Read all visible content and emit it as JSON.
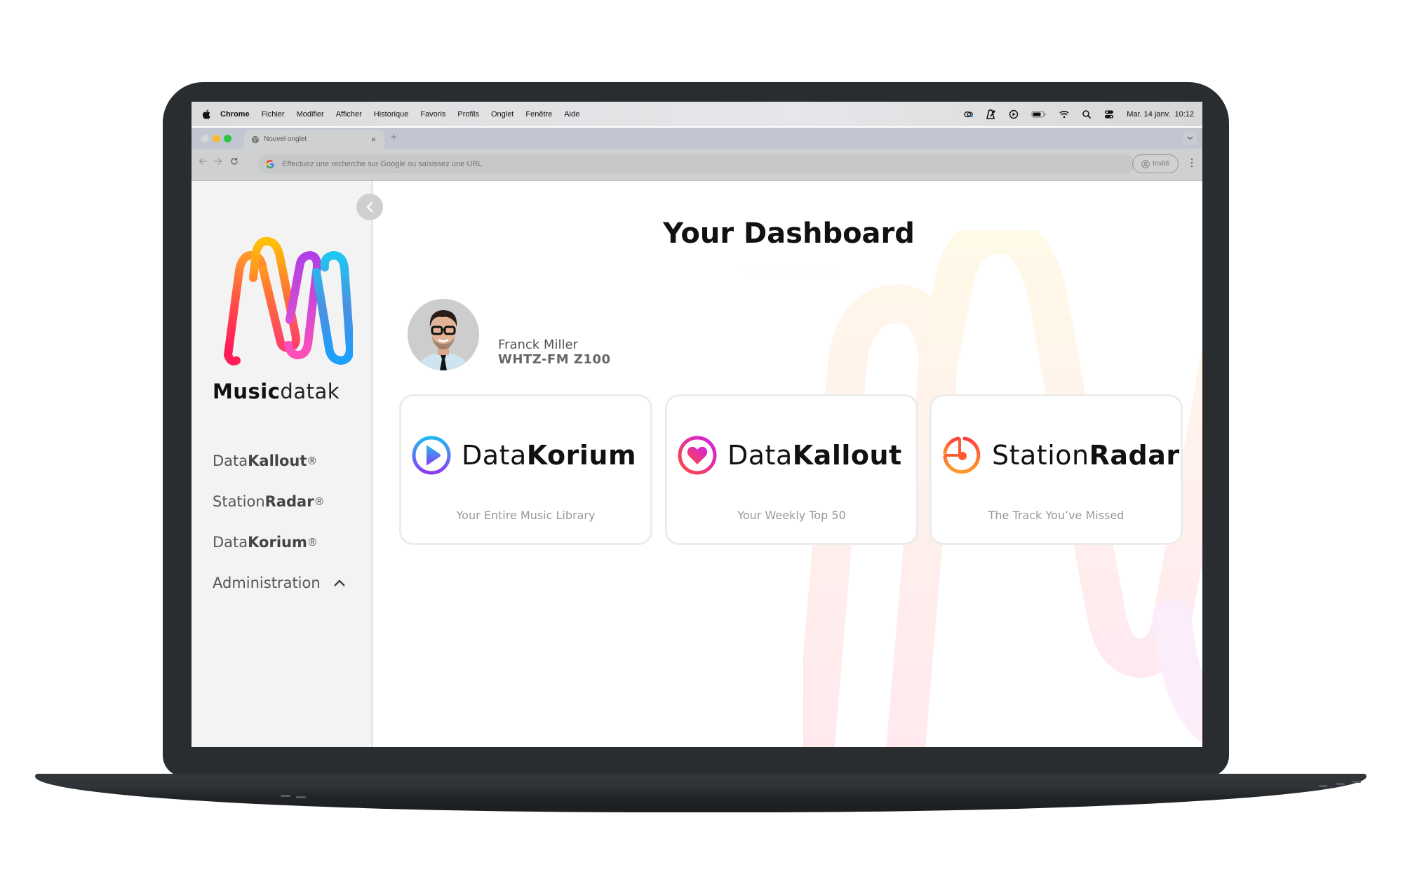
{
  "menubar": {
    "app_name": "Chrome",
    "menus": [
      "Fichier",
      "Modifier",
      "Afficher",
      "Historique",
      "Favoris",
      "Profils",
      "Onglet",
      "Fenêtre",
      "Aide"
    ],
    "status_icons": [
      "creative-cloud-icon",
      "metronome-icon",
      "play-circle-icon",
      "battery-icon",
      "wifi-icon",
      "spotlight-search-icon",
      "control-center-icon"
    ],
    "datetime": "Mar. 14 janv.  10:12"
  },
  "browser": {
    "tab_title": "Nouvel onglet",
    "tab_close": "×",
    "new_tab": "+",
    "omnibox_placeholder": "Effectuez une recherche sur Google ou saisissez une URL",
    "profile_label": "Invité",
    "colors": {
      "close": "#d6d6d6",
      "minimize": "#f5bd2f",
      "maximize": "#2ac840"
    }
  },
  "sidebar": {
    "brand_bold": "Music",
    "brand_light": "datak",
    "nav": [
      {
        "prefix": "Data",
        "bold": "Kallout",
        "mark": "®"
      },
      {
        "prefix": "Station",
        "bold": "Radar",
        "mark": "®"
      },
      {
        "prefix": "Data",
        "bold": "Korium",
        "mark": "®"
      },
      {
        "prefix": "Administration",
        "bold": "",
        "mark": ""
      }
    ]
  },
  "main": {
    "title": "Your Dashboard",
    "date": "Tue Jan 09 2025",
    "user": {
      "name": "Franck Miller",
      "station": "WHTZ-FM Z100"
    },
    "cards": [
      {
        "prefix": "Data",
        "bold": "Korium",
        "description": "Your Entire Music Library",
        "icon": "play-circle-icon"
      },
      {
        "prefix": "Data",
        "bold": "Kallout",
        "description": "Your Weekly Top 50",
        "icon": "heart-circle-icon"
      },
      {
        "prefix": "Station",
        "bold": "Radar",
        "description": "The Track You’ve Missed",
        "icon": "radar-clock-icon"
      }
    ]
  }
}
